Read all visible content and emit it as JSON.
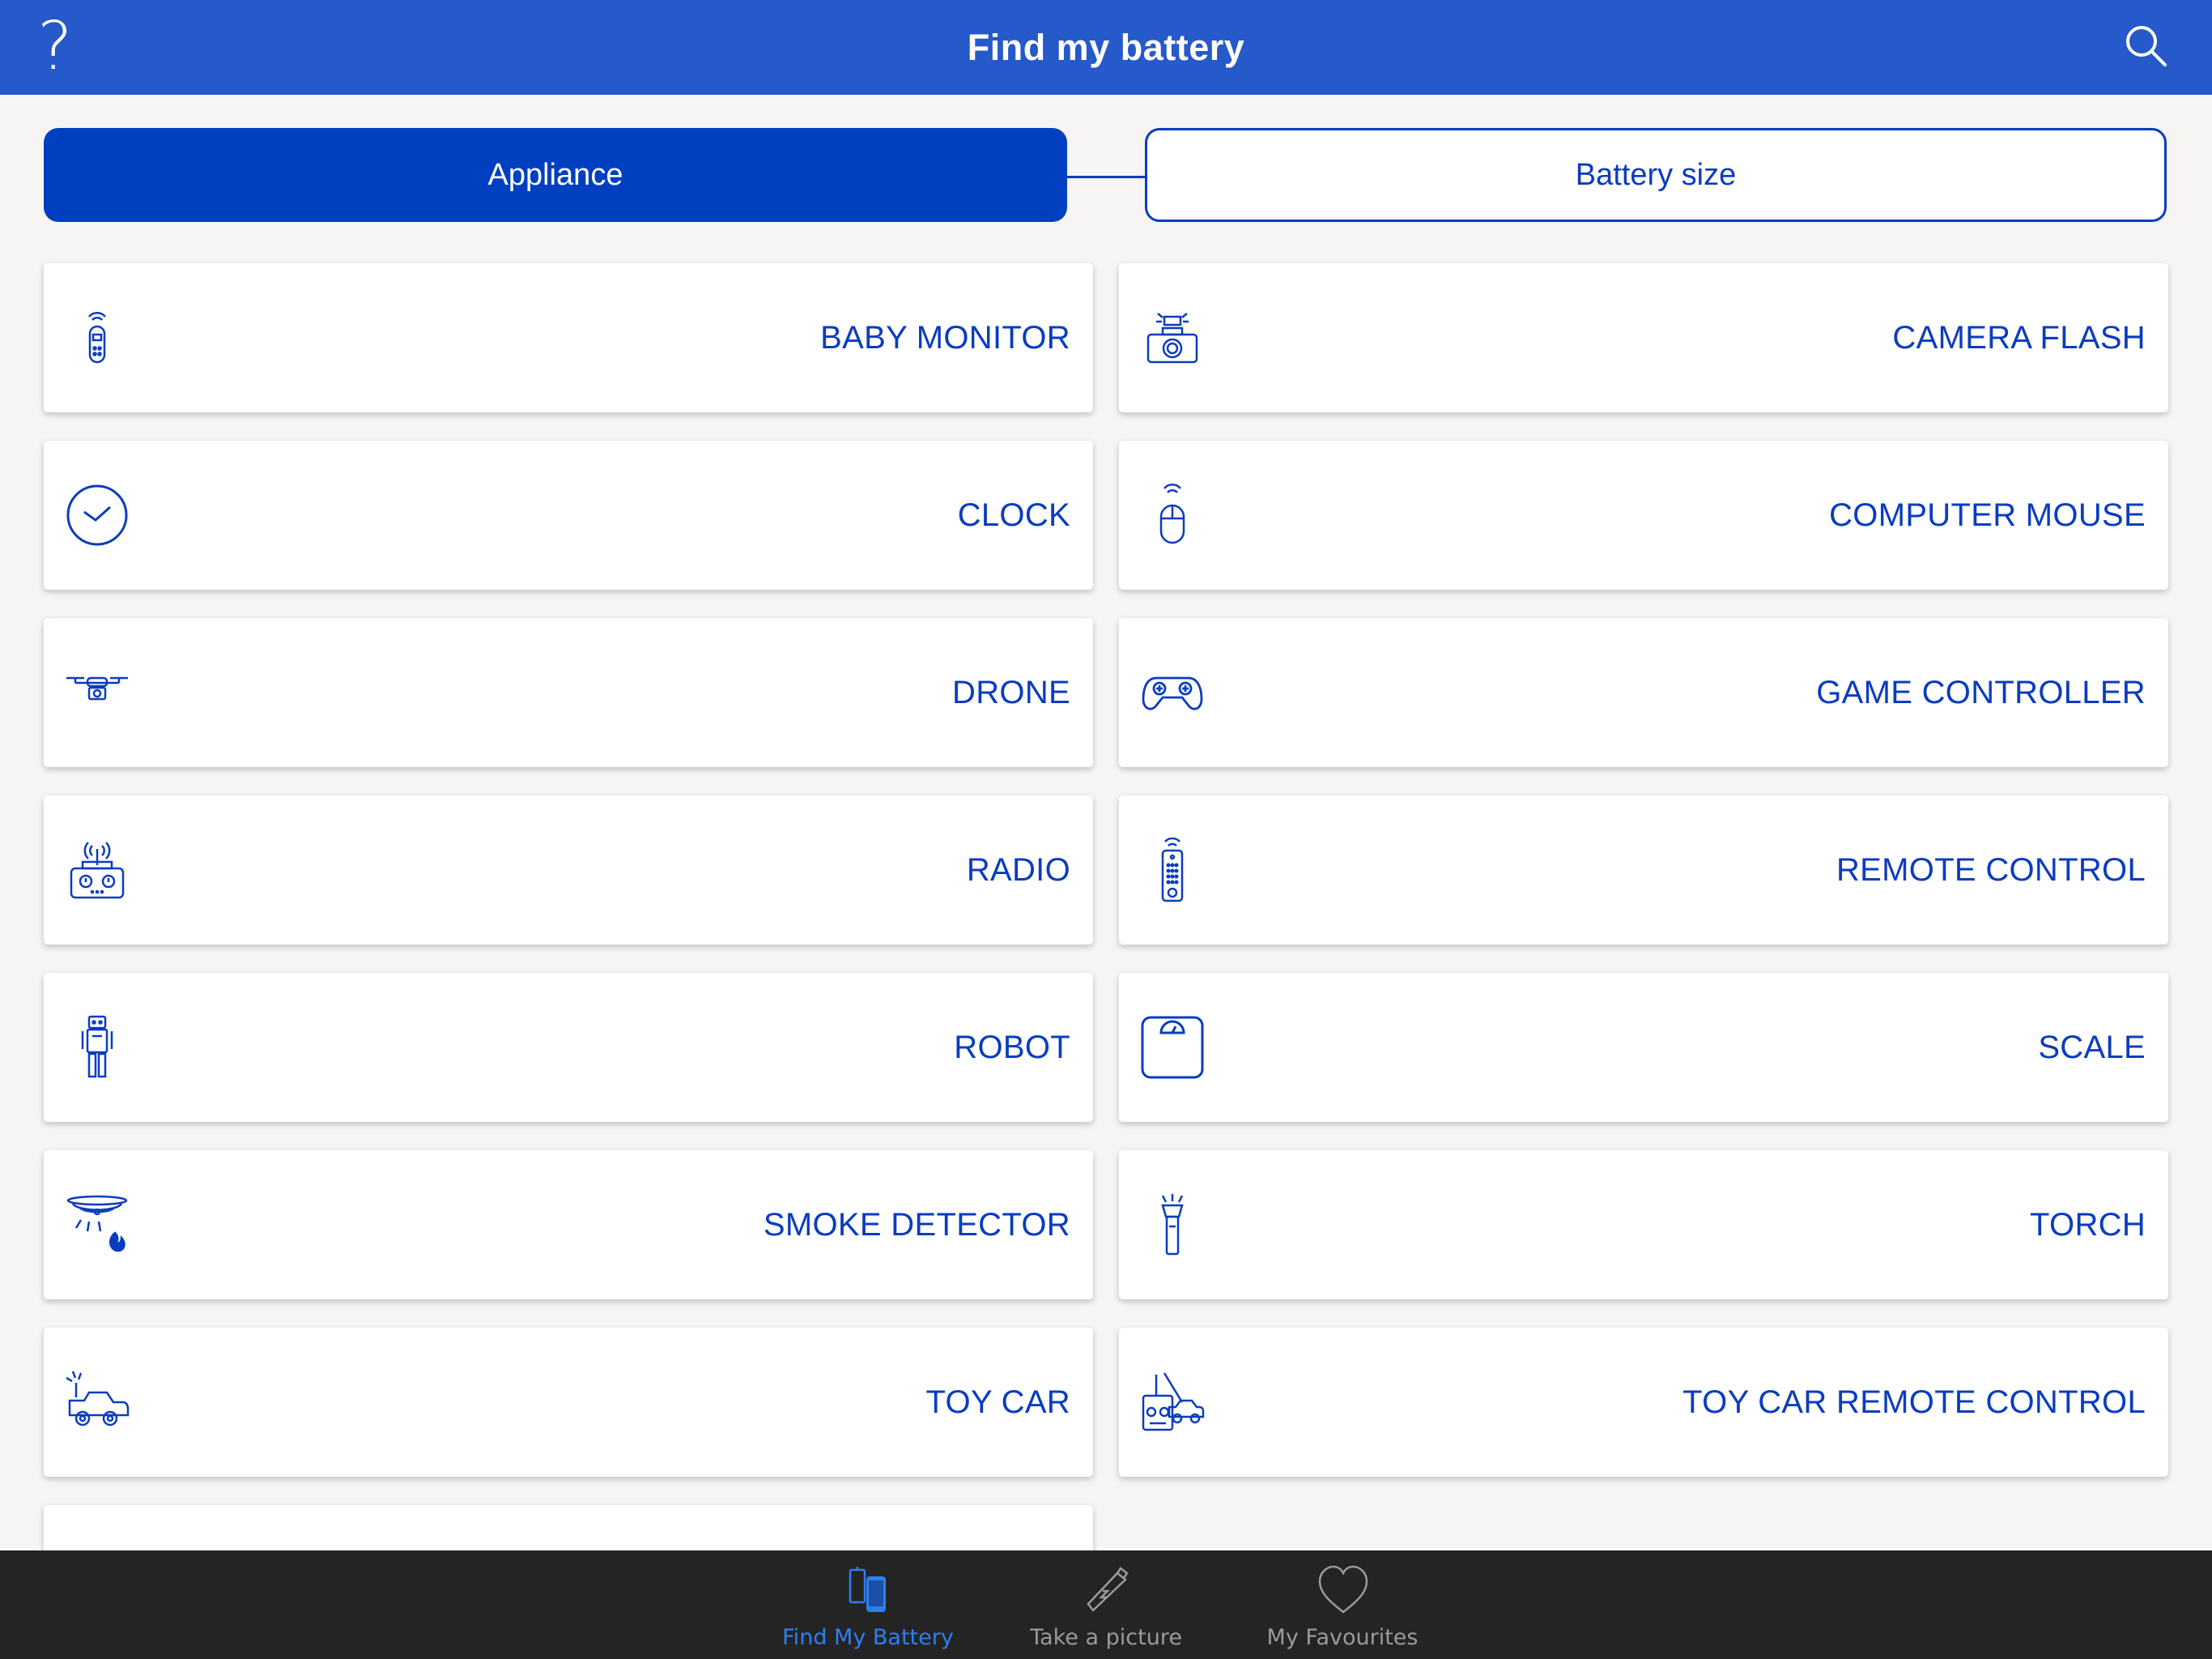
{
  "header": {
    "title": "Find my battery",
    "help_label": "?",
    "search_icon": "search-icon",
    "background": "#2659c9"
  },
  "segments": {
    "appliance": "Appliance",
    "battery_size": "Battery size",
    "selected": "Appliance",
    "accent": "#0040c0"
  },
  "appliances": [
    {
      "label": "BABY MONITOR",
      "icon": "baby-monitor-icon"
    },
    {
      "label": "CAMERA FLASH",
      "icon": "camera-flash-icon"
    },
    {
      "label": "CLOCK",
      "icon": "clock-icon"
    },
    {
      "label": "COMPUTER MOUSE",
      "icon": "computer-mouse-icon"
    },
    {
      "label": "DRONE",
      "icon": "drone-icon"
    },
    {
      "label": "GAME CONTROLLER",
      "icon": "game-controller-icon"
    },
    {
      "label": "RADIO",
      "icon": "radio-icon"
    },
    {
      "label": "REMOTE CONTROL",
      "icon": "remote-control-icon"
    },
    {
      "label": "ROBOT",
      "icon": "robot-icon"
    },
    {
      "label": "SCALE",
      "icon": "scale-icon"
    },
    {
      "label": "SMOKE DETECTOR",
      "icon": "smoke-detector-icon"
    },
    {
      "label": "TORCH",
      "icon": "torch-icon"
    },
    {
      "label": "TOY CAR",
      "icon": "toy-car-icon"
    },
    {
      "label": "TOY CAR REMOTE CONTROL",
      "icon": "toy-car-remote-icon"
    }
  ],
  "tabbar": {
    "items": [
      {
        "label": "Find My Battery",
        "icon": "find-battery-icon",
        "active": true
      },
      {
        "label": "Take a picture",
        "icon": "camera-battery-icon",
        "active": false
      },
      {
        "label": "My Favourites",
        "icon": "heart-icon",
        "active": false
      }
    ],
    "active_color": "#2e7ff0",
    "inactive_color": "#9a9a9a"
  }
}
